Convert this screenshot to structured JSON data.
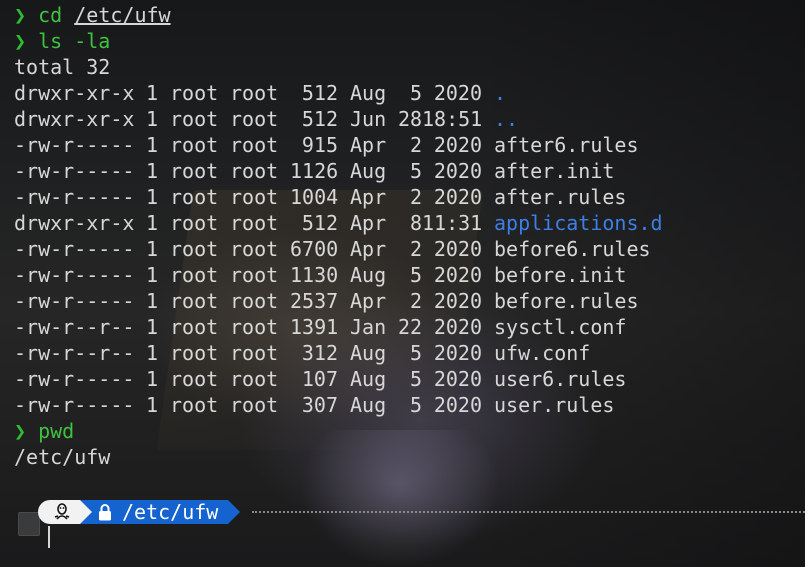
{
  "session": [
    {
      "prompt": "❯",
      "command": "cd",
      "argument": "/etc/ufw"
    },
    {
      "prompt": "❯",
      "command": "ls -la"
    }
  ],
  "total_line": "total 32",
  "listing": [
    {
      "perm": "drwxr-xr-x",
      "links": "1",
      "owner": "root",
      "group": "root",
      "size": "512",
      "month": "Aug",
      "day": "5",
      "time": "2020",
      "name": ".",
      "type": "dir"
    },
    {
      "perm": "drwxr-xr-x",
      "links": "1",
      "owner": "root",
      "group": "root",
      "size": "512",
      "month": "Jun",
      "day": "28",
      "time": "18:51",
      "name": "..",
      "type": "dir"
    },
    {
      "perm": "-rw-r-----",
      "links": "1",
      "owner": "root",
      "group": "root",
      "size": "915",
      "month": "Apr",
      "day": "2",
      "time": "2020",
      "name": "after6.rules",
      "type": "file"
    },
    {
      "perm": "-rw-r-----",
      "links": "1",
      "owner": "root",
      "group": "root",
      "size": "1126",
      "month": "Aug",
      "day": "5",
      "time": "2020",
      "name": "after.init",
      "type": "file"
    },
    {
      "perm": "-rw-r-----",
      "links": "1",
      "owner": "root",
      "group": "root",
      "size": "1004",
      "month": "Apr",
      "day": "2",
      "time": "2020",
      "name": "after.rules",
      "type": "file"
    },
    {
      "perm": "drwxr-xr-x",
      "links": "1",
      "owner": "root",
      "group": "root",
      "size": "512",
      "month": "Apr",
      "day": "8",
      "time": "11:31",
      "name": "applications.d",
      "type": "dir"
    },
    {
      "perm": "-rw-r-----",
      "links": "1",
      "owner": "root",
      "group": "root",
      "size": "6700",
      "month": "Apr",
      "day": "2",
      "time": "2020",
      "name": "before6.rules",
      "type": "file"
    },
    {
      "perm": "-rw-r-----",
      "links": "1",
      "owner": "root",
      "group": "root",
      "size": "1130",
      "month": "Aug",
      "day": "5",
      "time": "2020",
      "name": "before.init",
      "type": "file"
    },
    {
      "perm": "-rw-r-----",
      "links": "1",
      "owner": "root",
      "group": "root",
      "size": "2537",
      "month": "Apr",
      "day": "2",
      "time": "2020",
      "name": "before.rules",
      "type": "file"
    },
    {
      "perm": "-rw-r--r--",
      "links": "1",
      "owner": "root",
      "group": "root",
      "size": "1391",
      "month": "Jan",
      "day": "22",
      "time": "2020",
      "name": "sysctl.conf",
      "type": "file"
    },
    {
      "perm": "-rw-r--r--",
      "links": "1",
      "owner": "root",
      "group": "root",
      "size": "312",
      "month": "Aug",
      "day": "5",
      "time": "2020",
      "name": "ufw.conf",
      "type": "file"
    },
    {
      "perm": "-rw-r-----",
      "links": "1",
      "owner": "root",
      "group": "root",
      "size": "107",
      "month": "Aug",
      "day": "5",
      "time": "2020",
      "name": "user6.rules",
      "type": "file"
    },
    {
      "perm": "-rw-r-----",
      "links": "1",
      "owner": "root",
      "group": "root",
      "size": "307",
      "month": "Aug",
      "day": "5",
      "time": "2020",
      "name": "user.rules",
      "type": "file"
    }
  ],
  "pwd_command": {
    "prompt": "❯",
    "command": "pwd"
  },
  "pwd_output": "/etc/ufw",
  "powerline": {
    "os_icon": "linux-tux-icon",
    "lock_icon": "lock-icon",
    "path": "/etc/ufw"
  },
  "colors": {
    "prompt_green": "#2fbe2f",
    "directory_blue": "#3d7fe6",
    "powerline_blue": "#1463cf",
    "text": "#d7d7d7"
  }
}
